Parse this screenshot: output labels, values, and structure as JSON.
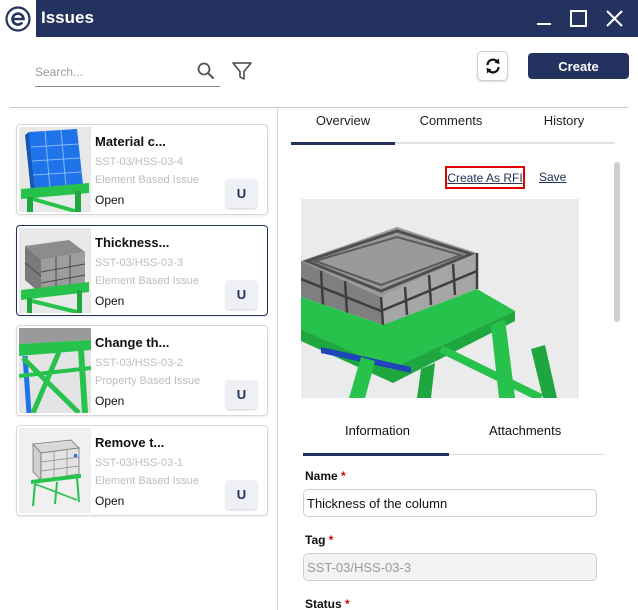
{
  "window": {
    "title": "Issues",
    "logo_letter": "e"
  },
  "toolbar": {
    "search_placeholder": "Search...",
    "create_label": "Create"
  },
  "issues": [
    {
      "title": "Material c...",
      "tag": "SST-03/HSS-03-4",
      "type": "Element Based Issue",
      "status": "Open",
      "badge": "U",
      "selected": false
    },
    {
      "title": "Thickness...",
      "tag": "SST-03/HSS-03-3",
      "type": "Element Based Issue",
      "status": "Open",
      "badge": "U",
      "selected": true
    },
    {
      "title": "Change th...",
      "tag": "SST-03/HSS-03-2",
      "type": "Property Based Issue",
      "status": "Open",
      "badge": "U",
      "selected": false
    },
    {
      "title": "Remove t...",
      "tag": "SST-03/HSS-03-1",
      "type": "Element Based Issue",
      "status": "Open",
      "badge": "U",
      "selected": false
    }
  ],
  "detail": {
    "tabs": [
      {
        "label": "Overview",
        "active": true
      },
      {
        "label": "Comments",
        "active": false
      },
      {
        "label": "History",
        "active": false
      }
    ],
    "create_rfi_label": "Create As RFI",
    "save_label": "Save",
    "subtabs": [
      {
        "label": "Information",
        "active": true
      },
      {
        "label": "Attachments",
        "active": false
      }
    ],
    "fields": {
      "name_label": "Name",
      "name_value": "Thickness of the column",
      "tag_label": "Tag",
      "tag_value": "SST-03/HSS-03-3",
      "status_label": "Status",
      "required_mark": "*"
    }
  },
  "colors": {
    "primary": "#23325e",
    "highlight_border": "#e10000",
    "required": "#d00000",
    "model_green": "#27c24c",
    "model_blue": "#1e73e8"
  }
}
